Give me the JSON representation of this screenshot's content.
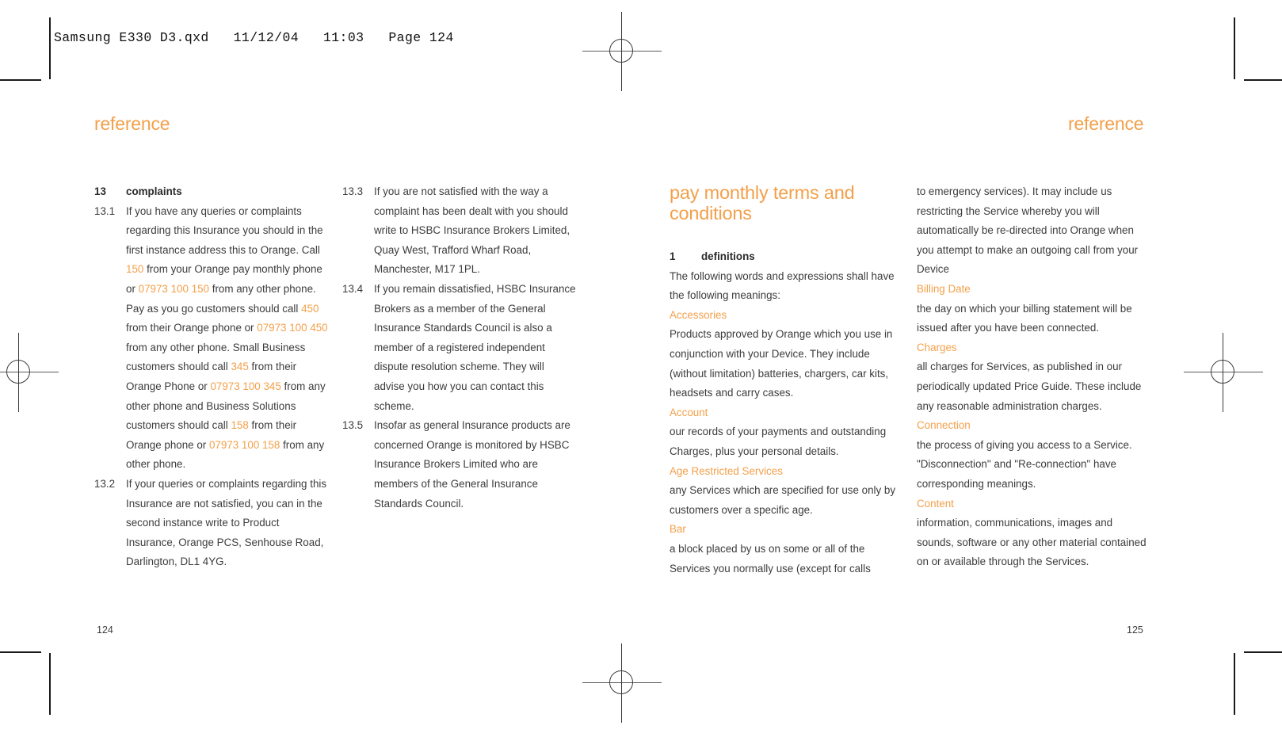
{
  "slug": "Samsung E330 D3.qxd   11/12/04   11:03   Page 124",
  "accent_color": "#F3A04A",
  "text_color": "#3c3c3c",
  "left_page": {
    "running_head": "reference",
    "folio": "124",
    "column_1": {
      "heading_number": "13",
      "heading_label": "complaints",
      "clauses": [
        {
          "number": "13.1",
          "segments": [
            {
              "text": "If you have any queries or complaints regarding this Insurance you should in the first instance address this to Orange. Call ",
              "accent": false
            },
            {
              "text": "150",
              "accent": true
            },
            {
              "text": " from your Orange pay monthly phone or ",
              "accent": false
            },
            {
              "text": "07973 100 150",
              "accent": true
            },
            {
              "text": " from any other phone. Pay as you go customers should call ",
              "accent": false
            },
            {
              "text": "450",
              "accent": true
            },
            {
              "text": " from their Orange phone or ",
              "accent": false
            },
            {
              "text": "07973 100 450",
              "accent": true
            },
            {
              "text": " from any other phone. Small Business customers should call ",
              "accent": false
            },
            {
              "text": "345",
              "accent": true
            },
            {
              "text": " from their Orange Phone or ",
              "accent": false
            },
            {
              "text": "07973 100 345",
              "accent": true
            },
            {
              "text": " from any other phone and Business Solutions customers should call ",
              "accent": false
            },
            {
              "text": "158",
              "accent": true
            },
            {
              "text": " from their Orange phone or ",
              "accent": false
            },
            {
              "text": "07973 100 158",
              "accent": true
            },
            {
              "text": " from any other phone.",
              "accent": false
            }
          ]
        },
        {
          "number": "13.2",
          "segments": [
            {
              "text": "If your queries or complaints regarding this Insurance are not satisfied, you can in the second instance write to Product Insurance, Orange PCS, Senhouse Road, Darlington, DL1 4YG.",
              "accent": false
            }
          ]
        }
      ]
    },
    "column_2": {
      "clauses": [
        {
          "number": "13.3",
          "segments": [
            {
              "text": "If you are not satisfied with the way a complaint has been dealt with you should write to HSBC Insurance Brokers Limited, Quay West, Trafford Wharf Road, Manchester, M17 1PL.",
              "accent": false
            }
          ]
        },
        {
          "number": "13.4",
          "segments": [
            {
              "text": "If you remain dissatisfied, HSBC Insurance Brokers as a member of the General Insurance Standards Council is also a member of a registered independent dispute resolution scheme. They will advise you how you can contact this scheme.",
              "accent": false
            }
          ]
        },
        {
          "number": "13.5",
          "segments": [
            {
              "text": "Insofar as general Insurance products are concerned Orange is monitored by HSBC Insurance Brokers Limited who are members of the General Insurance Standards Council.",
              "accent": false
            }
          ]
        }
      ]
    }
  },
  "right_page": {
    "running_head": "reference",
    "folio": "125",
    "chapter_title": "pay monthly terms and conditions",
    "column_3": {
      "heading_number": "1",
      "heading_label": "definitions",
      "intro": "The following words and expressions shall have the following meanings:",
      "definitions": [
        {
          "term": "Accessories",
          "definition": "Products approved by Orange which you use in conjunction with your Device. They include (without limitation) batteries, chargers, car kits, headsets and carry cases."
        },
        {
          "term": "Account",
          "definition": "our records of your payments and outstanding Charges, plus your personal details."
        },
        {
          "term": "Age Restricted Services",
          "definition": "any Services which are specified for use only by customers over a specific age."
        },
        {
          "term": "Bar",
          "definition": "a block placed by us on some or all of the Services you normally use (except for calls"
        }
      ]
    },
    "column_4": {
      "continuation": "to emergency services). It may include us restricting the Service whereby you will automatically be re-directed into Orange when you attempt to make an outgoing call from your Device",
      "definitions": [
        {
          "term": "Billing Date",
          "definition": "the day on which your billing statement will be issued after you have been connected."
        },
        {
          "term": "Charges",
          "definition": "all charges for Services, as published in our periodically updated Price Guide. These include any reasonable administration charges."
        },
        {
          "term": "Connection",
          "definition": "the process of giving you access to a Service. \"Disconnection\" and \"Re-connection\" have corresponding meanings."
        },
        {
          "term": "Content",
          "definition": "information, communications, images and sounds, software or any other material contained on or available through the Services."
        }
      ]
    }
  }
}
